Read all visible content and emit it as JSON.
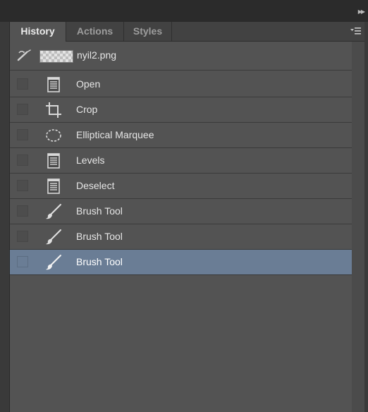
{
  "panel": {
    "tabs": [
      {
        "label": "History",
        "active": true
      },
      {
        "label": "Actions",
        "active": false
      },
      {
        "label": "Styles",
        "active": false
      }
    ],
    "menu_icon": "panel-menu-icon",
    "collapse_icon": "double-chevron-right-icon"
  },
  "snapshot": {
    "label": "nyil2.png",
    "source_icon": "history-brush-icon"
  },
  "history": {
    "items": [
      {
        "label": "Open",
        "icon": "document-icon",
        "selected": false
      },
      {
        "label": "Crop",
        "icon": "crop-icon",
        "selected": false
      },
      {
        "label": "Elliptical Marquee",
        "icon": "elliptical-marquee-icon",
        "selected": false
      },
      {
        "label": "Levels",
        "icon": "document-icon",
        "selected": false
      },
      {
        "label": "Deselect",
        "icon": "document-icon",
        "selected": false
      },
      {
        "label": "Brush Tool",
        "icon": "brush-icon",
        "selected": false
      },
      {
        "label": "Brush Tool",
        "icon": "brush-icon",
        "selected": false
      },
      {
        "label": "Brush Tool",
        "icon": "brush-icon",
        "selected": true
      }
    ]
  },
  "colors": {
    "selected_row": "#6a7d95",
    "panel_bg": "#535353"
  }
}
